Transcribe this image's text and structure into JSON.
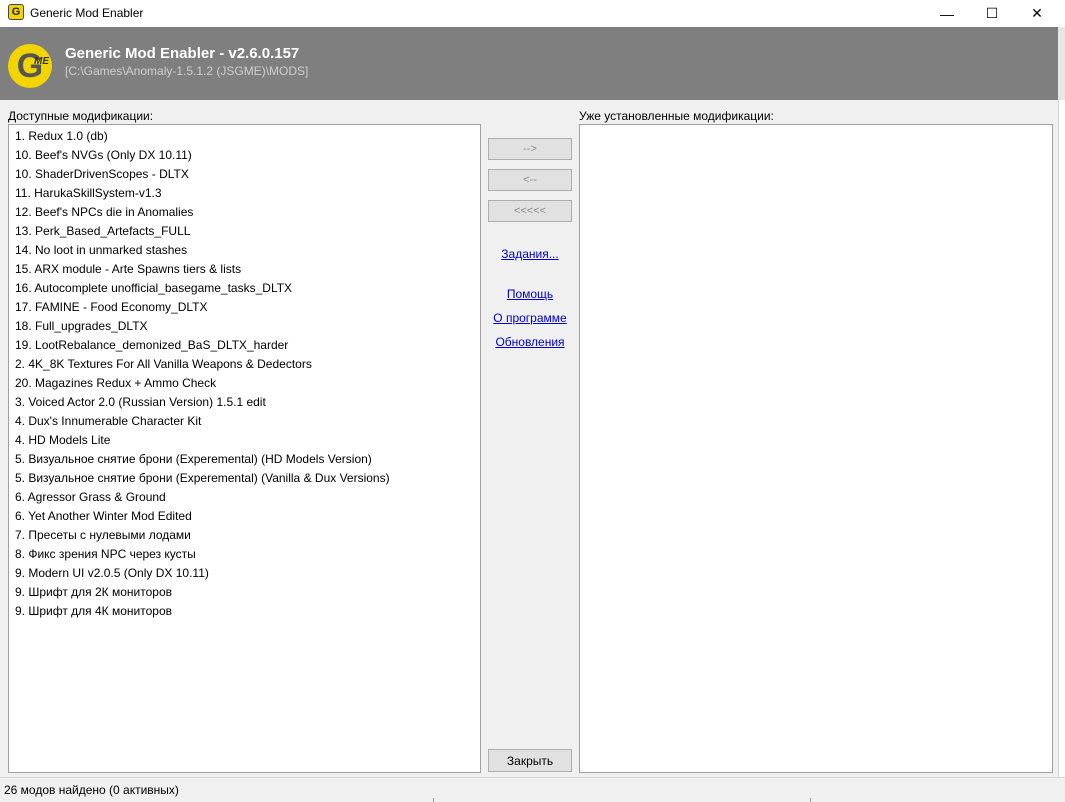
{
  "window": {
    "title": "Generic Mod Enabler",
    "minimize_glyph": "—",
    "maximize_glyph": "☐",
    "close_glyph": "✕"
  },
  "header": {
    "logo_letter": "G",
    "logo_sub": "ME",
    "title": "Generic Mod Enabler - v2.6.0.157",
    "path": "[C:\\Games\\Anomaly-1.5.1.2 (JSGME)\\MODS]",
    "background": "#7f7f7f",
    "logo_color": "#f2d500"
  },
  "available": {
    "label": "Доступные модификации:",
    "items": [
      "1. Redux 1.0 (db)",
      "10. Beef's NVGs (Only DX 10.11)",
      "10. ShaderDrivenScopes - DLTX",
      "11. HarukaSkillSystem-v1.3",
      "12. Beef's NPCs die in Anomalies",
      "13. Perk_Based_Artefacts_FULL",
      "14. No loot in unmarked stashes",
      "15. ARX module - Arte  Spawns tiers & lists",
      "16. Autocomplete unofficial_basegame_tasks_DLTX",
      "17. FAMINE - Food Economy_DLTX",
      "18. Full_upgrades_DLTX",
      "19. LootRebalance_demonized_BaS_DLTX_harder",
      "2. 4K_8K Textures For All Vanilla Weapons & Dedectors",
      "20. Magazines Redux + Ammo Check",
      "3. Voiced Actor 2.0 (Russian Version) 1.5.1 edit",
      "4. Dux's Innumerable Character Kit",
      "4. HD Models Lite",
      "5. Визуальное снятие брони (Experemental) (HD Models Version)",
      "5. Визуальное снятие брони (Experemental) (Vanilla & Dux Versions)",
      "6. Agressor Grass & Ground",
      "6. Yet Another Winter Mod Edited",
      "7. Пресеты с нулевыми лодами",
      "8. Фикс зрения NPC через кусты",
      "9. Modern UI v2.0.5 (Only DX 10.11)",
      "9. Шрифт для 2К мониторов",
      "9. Шрифт для 4К мониторов"
    ]
  },
  "installed": {
    "label": "Уже установленные модификации:",
    "items": []
  },
  "buttons": {
    "activate": "-->",
    "deactivate": "<--",
    "deactivate_all": "<<<<<",
    "close": "Закрыть"
  },
  "links": {
    "tasks": "Задания...",
    "help": "Помощь",
    "about": "О программе",
    "updates": "Обновления"
  },
  "status": {
    "text": "26 модов найдено (0 активных)"
  }
}
